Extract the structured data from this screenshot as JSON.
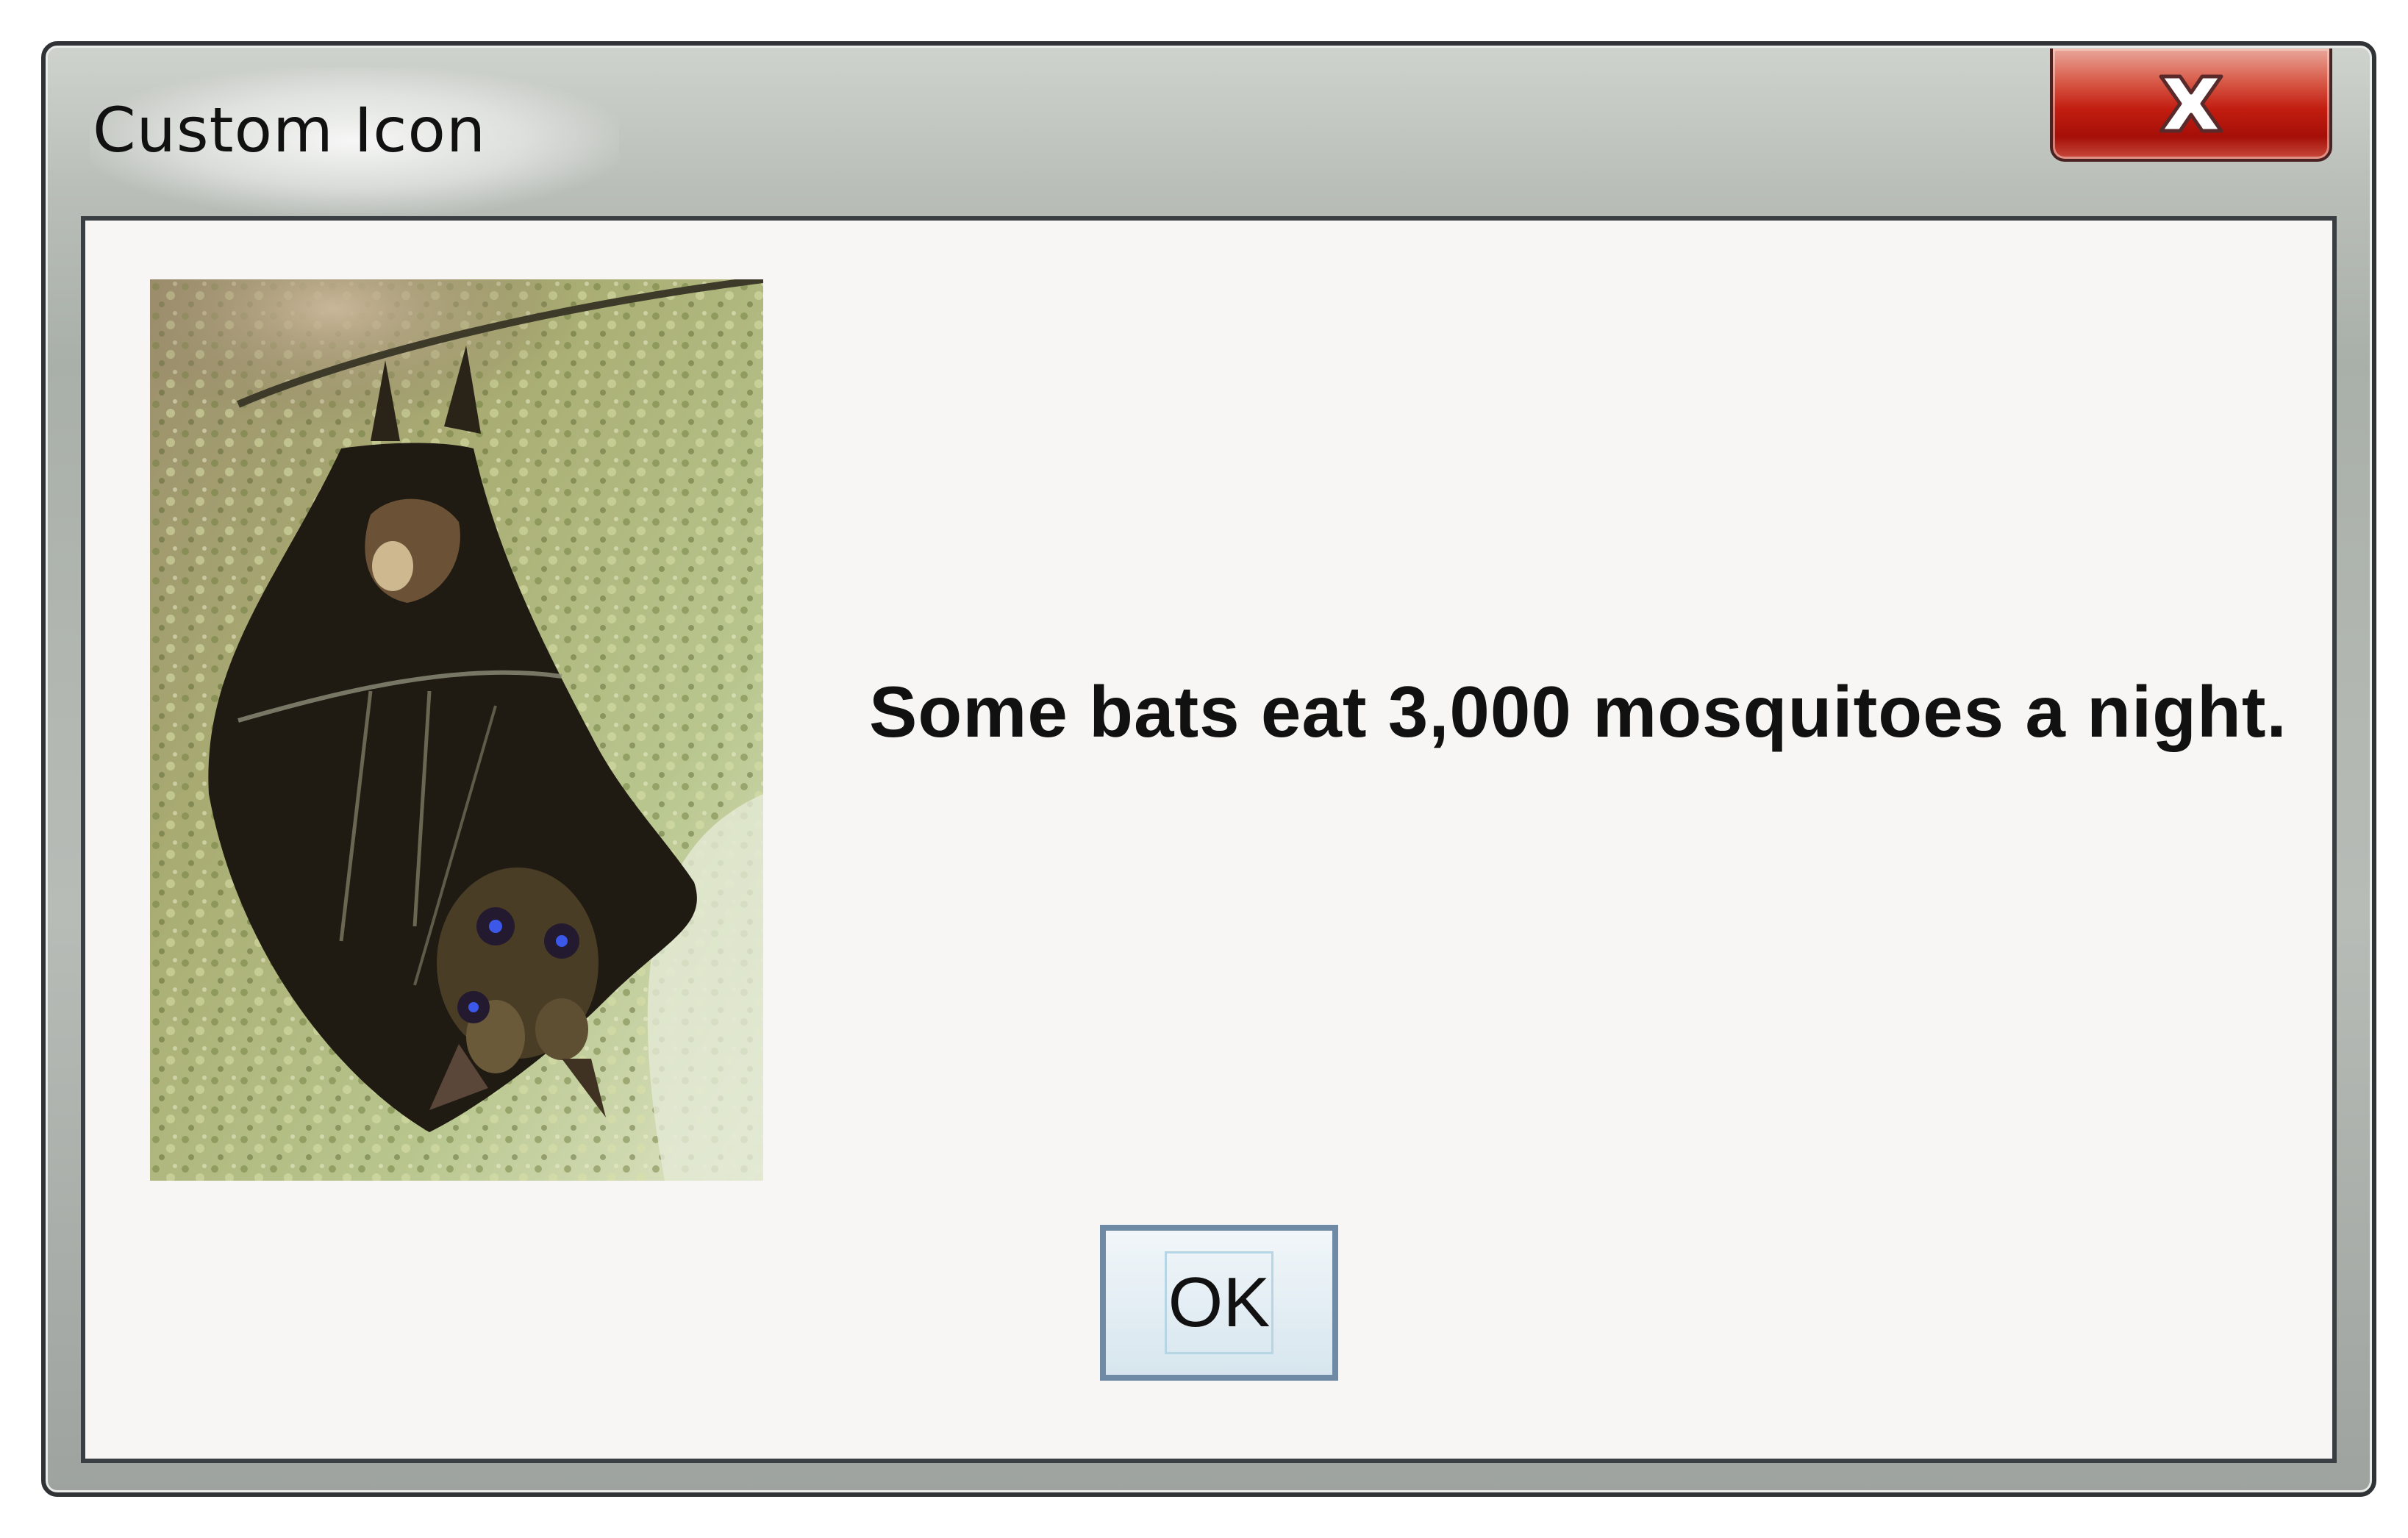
{
  "window": {
    "title": "Custom Icon"
  },
  "titlebar": {
    "close_icon": "close-x-icon",
    "close_color": "#c21d10"
  },
  "dialog": {
    "message": "Some bats eat 3,000 mosquitoes a night.",
    "icon": "bat-photo",
    "ok_label": "OK"
  },
  "colors": {
    "client_background": "#f7f6f4",
    "button_border": "#6e8aa4"
  }
}
